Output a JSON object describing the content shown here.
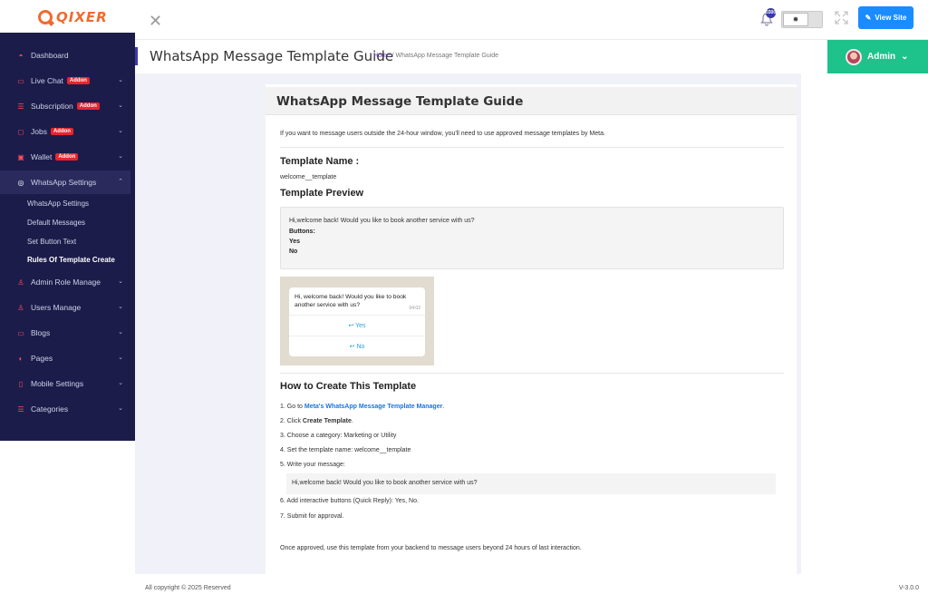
{
  "brand": {
    "logo_text": "QIXER"
  },
  "topbar": {
    "notification_count": "0300",
    "theme_toggle_icon": "sun-icon",
    "view_site_label": "View Site"
  },
  "sidebar": {
    "addon_badge": "Addon",
    "items": [
      {
        "label": "Dashboard",
        "icon": "dashboard-icon"
      },
      {
        "label": "Live Chat",
        "icon": "chat-icon",
        "addon": true
      },
      {
        "label": "Subscription",
        "icon": "list-icon",
        "addon": true
      },
      {
        "label": "Jobs",
        "icon": "briefcase-icon",
        "addon": true
      },
      {
        "label": "Wallet",
        "icon": "wallet-icon",
        "addon": true
      },
      {
        "label": "WhatsApp Settings",
        "icon": "whatsapp-icon"
      },
      {
        "label": "Admin Role Manage",
        "icon": "user-icon"
      },
      {
        "label": "Users Manage",
        "icon": "user-icon"
      },
      {
        "label": "Blogs",
        "icon": "blog-icon"
      },
      {
        "label": "Pages",
        "icon": "pages-icon"
      },
      {
        "label": "Mobile Settings",
        "icon": "mobile-icon"
      },
      {
        "label": "Categories",
        "icon": "categories-icon"
      }
    ],
    "whatsapp_sub": [
      {
        "label": "WhatsApp Settings"
      },
      {
        "label": "Default Messages"
      },
      {
        "label": "Set Button Text"
      },
      {
        "label": "Rules Of Template Create"
      }
    ]
  },
  "page": {
    "title": "WhatsApp Message Template Guide",
    "breadcrumb_home": "Home",
    "breadcrumb_sep": "/",
    "breadcrumb_current": "WhatsApp Message Template Guide",
    "admin_label": "Admin"
  },
  "guide": {
    "card_title": "WhatsApp Message Template Guide",
    "intro": "If you want to message users outside the 24-hour window, you'll need to use approved message templates by Meta.",
    "template_name_heading": "Template Name :",
    "template_name": "welcome__template",
    "preview_heading": "Template Preview",
    "preview_message": "Hi,welcome back! Would you like to book another service with us?",
    "preview_buttons_label": "Buttons:",
    "preview_button_1": "Yes",
    "preview_button_2": "No",
    "wa_message": "Hi, welcome back! Would you like to book another service with us?",
    "wa_time": "04:02",
    "wa_button_1": "Yes",
    "wa_button_2": "No",
    "how_heading": "How to Create This Template",
    "steps": {
      "s1_prefix": "1. Go to ",
      "s1_link": "Meta's WhatsApp Message Template Manager",
      "s1_suffix": ".",
      "s2_prefix": "2. Click ",
      "s2_bold": "Create Template",
      "s2_suffix": ".",
      "s3": "3. Choose a category: Marketing or Utility",
      "s4": "4. Set the template name: welcome__template",
      "s5": "5. Write your message:",
      "s5_message": "Hi,welcome back! Would you like to book another service with us?",
      "s6": "6. Add interactive buttons (Quick Reply): Yes, No.",
      "s7": "7. Submit for approval."
    },
    "outro": "Once approved, use this template from your backend to message users beyond 24 hours of last interaction."
  },
  "footer": {
    "copyright": "All copyright © 2025 Reserved",
    "version": "V-3.0.0"
  }
}
